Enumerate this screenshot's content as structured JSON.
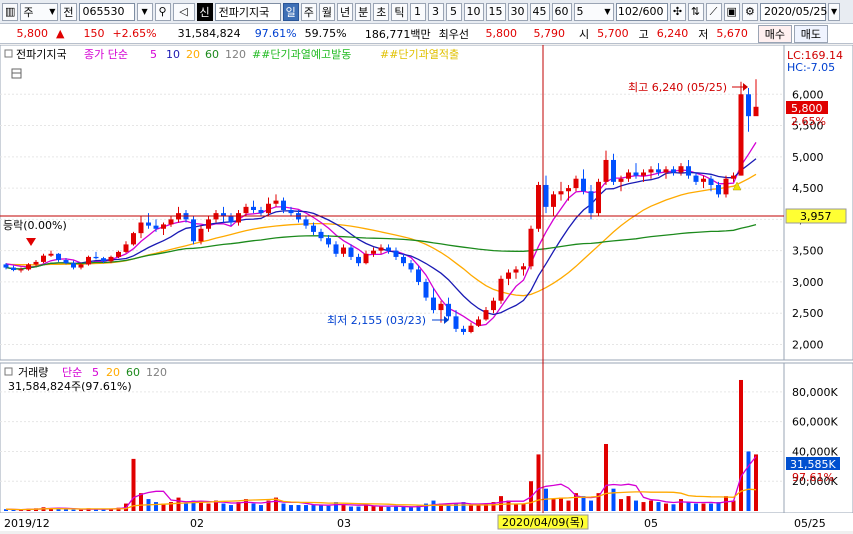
{
  "toolbar": {
    "market_label": "주",
    "type_label": "전",
    "stock_code": "065530",
    "stock_name": "전파기지국",
    "icon_si": "신",
    "period_tabs": [
      "일",
      "주",
      "월",
      "년",
      "분",
      "초",
      "틱"
    ],
    "period_numbers": [
      "1",
      "3",
      "5",
      "10",
      "15",
      "30",
      "45",
      "60"
    ],
    "count_value": "5",
    "page_count": "102/600",
    "date": "2020/05/25"
  },
  "quote": {
    "price": "5,800",
    "arrow": "▲",
    "change": "150",
    "change_pct": "+2.65%",
    "volume": "31,584,824",
    "vol_ratio": "97.61%",
    "turnover": "59.75%",
    "amount": "186,771백만",
    "best_label": "최우선",
    "ask": "5,800",
    "bid": "5,790",
    "open_label": "시",
    "open": "5,700",
    "high_label": "고",
    "high": "6,240",
    "low_label": "저",
    "low": "5,670",
    "buy_label": "매수",
    "sell_label": "매도"
  },
  "price_panel": {
    "legend_name": "전파기지국",
    "legend_ma": "종가 단순",
    "ma_periods": [
      "5",
      "10",
      "20",
      "60",
      "120"
    ],
    "legend_signal1": "##단기과열예고발동",
    "legend_signal2": "##단기과열적출",
    "lc_label": "LC:169.14",
    "hc_label": "HC:-7.05",
    "crosshair_text": "등락(0.00%)",
    "high_annot": "최고 6,240 (05/25)",
    "low_annot": "최저 2,155 (03/23)",
    "y_ticks": [
      "6,000",
      "5,500",
      "5,000",
      "4,500",
      "4,000",
      "3,500",
      "3,000",
      "2,500",
      "2,000"
    ],
    "last_price_tag": "5,800",
    "last_pct_tag": "2.65%",
    "crosshair_price_tag": "3,957"
  },
  "volume_panel": {
    "legend_name": "거래량",
    "legend_ma": "단순",
    "ma_periods": [
      "5",
      "20",
      "60",
      "120"
    ],
    "vol_info": "31,584,824주(97.61%)",
    "y_ticks": [
      "80,000K",
      "60,000K",
      "40,000K",
      "20,000K"
    ],
    "vol_tag": "31,585K",
    "pct_tag": "97.61%"
  },
  "x_axis": {
    "labels": [
      "2019/12",
      "02",
      "03",
      "05",
      "05/25"
    ],
    "crosshair_date": "2020/04/09(목)"
  },
  "colors": {
    "up": "#e00000",
    "down": "#0050ff",
    "ma5": "#d400d4",
    "ma10": "#1a1ab4",
    "ma20": "#ffaa00",
    "ma60": "#1c8a1c",
    "ma120": "#808080"
  },
  "chart_data": {
    "type": "candlestick",
    "price_range": [
      1800,
      6500
    ],
    "volume_max": 90000,
    "candles": [
      [
        3280,
        3300,
        3200,
        3230
      ],
      [
        3230,
        3260,
        3170,
        3190
      ],
      [
        3190,
        3230,
        3150,
        3200
      ],
      [
        3200,
        3300,
        3180,
        3280
      ],
      [
        3280,
        3350,
        3250,
        3320
      ],
      [
        3320,
        3450,
        3300,
        3420
      ],
      [
        3420,
        3500,
        3400,
        3450
      ],
      [
        3450,
        3460,
        3320,
        3350
      ],
      [
        3350,
        3380,
        3280,
        3300
      ],
      [
        3300,
        3340,
        3200,
        3230
      ],
      [
        3230,
        3300,
        3200,
        3280
      ],
      [
        3280,
        3420,
        3260,
        3400
      ],
      [
        3400,
        3480,
        3360,
        3380
      ],
      [
        3380,
        3400,
        3300,
        3330
      ],
      [
        3330,
        3420,
        3300,
        3400
      ],
      [
        3400,
        3500,
        3380,
        3480
      ],
      [
        3480,
        3650,
        3460,
        3600
      ],
      [
        3600,
        3800,
        3580,
        3780
      ],
      [
        3780,
        4050,
        3700,
        3950
      ],
      [
        3950,
        4100,
        3850,
        3900
      ],
      [
        3900,
        4000,
        3800,
        3850
      ],
      [
        3850,
        3950,
        3750,
        3920
      ],
      [
        3920,
        4050,
        3880,
        4000
      ],
      [
        4000,
        4200,
        3950,
        4100
      ],
      [
        4100,
        4150,
        3950,
        4000
      ],
      [
        4000,
        4050,
        3600,
        3650
      ],
      [
        3650,
        3900,
        3600,
        3850
      ],
      [
        3850,
        4050,
        3800,
        4000
      ],
      [
        4000,
        4150,
        3950,
        4100
      ],
      [
        4100,
        4200,
        3950,
        4050
      ],
      [
        4050,
        4100,
        3900,
        3950
      ],
      [
        3950,
        4150,
        3900,
        4100
      ],
      [
        4100,
        4250,
        4050,
        4200
      ],
      [
        4200,
        4300,
        4100,
        4150
      ],
      [
        4150,
        4200,
        4050,
        4100
      ],
      [
        4100,
        4350,
        4050,
        4250
      ],
      [
        4250,
        4400,
        4200,
        4300
      ],
      [
        4300,
        4350,
        4100,
        4150
      ],
      [
        4150,
        4200,
        4050,
        4100
      ],
      [
        4100,
        4150,
        3950,
        4000
      ],
      [
        4000,
        4050,
        3850,
        3900
      ],
      [
        3900,
        3950,
        3750,
        3800
      ],
      [
        3800,
        3850,
        3650,
        3700
      ],
      [
        3700,
        3750,
        3550,
        3600
      ],
      [
        3600,
        3650,
        3400,
        3450
      ],
      [
        3450,
        3600,
        3400,
        3550
      ],
      [
        3550,
        3600,
        3350,
        3400
      ],
      [
        3400,
        3450,
        3250,
        3300
      ],
      [
        3300,
        3500,
        3280,
        3450
      ],
      [
        3450,
        3550,
        3400,
        3500
      ],
      [
        3500,
        3600,
        3450,
        3550
      ],
      [
        3550,
        3600,
        3450,
        3500
      ],
      [
        3500,
        3550,
        3350,
        3400
      ],
      [
        3400,
        3450,
        3250,
        3300
      ],
      [
        3300,
        3350,
        3150,
        3200
      ],
      [
        3200,
        3250,
        2950,
        3000
      ],
      [
        3000,
        3050,
        2700,
        2750
      ],
      [
        2750,
        2900,
        2500,
        2550
      ],
      [
        2550,
        2700,
        2350,
        2650
      ],
      [
        2650,
        2750,
        2400,
        2450
      ],
      [
        2450,
        2550,
        2200,
        2250
      ],
      [
        2250,
        2300,
        2155,
        2200
      ],
      [
        2200,
        2350,
        2180,
        2300
      ],
      [
        2300,
        2450,
        2280,
        2400
      ],
      [
        2400,
        2600,
        2380,
        2550
      ],
      [
        2550,
        2750,
        2500,
        2700
      ],
      [
        2700,
        3100,
        2650,
        3050
      ],
      [
        3050,
        3200,
        2950,
        3150
      ],
      [
        3150,
        3250,
        3050,
        3200
      ],
      [
        3200,
        3300,
        3100,
        3250
      ],
      [
        3250,
        3900,
        3200,
        3850
      ],
      [
        3850,
        4600,
        3800,
        4550
      ],
      [
        4550,
        4700,
        4100,
        4200
      ],
      [
        4200,
        4450,
        4050,
        4400
      ],
      [
        4400,
        4600,
        4300,
        4450
      ],
      [
        4450,
        4550,
        4300,
        4500
      ],
      [
        4500,
        4700,
        4450,
        4650
      ],
      [
        4650,
        4800,
        4400,
        4450
      ],
      [
        4450,
        4550,
        4000,
        4100
      ],
      [
        4100,
        4650,
        4050,
        4600
      ],
      [
        4600,
        5100,
        4550,
        4950
      ],
      [
        4950,
        5050,
        4550,
        4600
      ],
      [
        4600,
        4700,
        4450,
        4650
      ],
      [
        4650,
        4800,
        4600,
        4750
      ],
      [
        4750,
        4900,
        4650,
        4700
      ],
      [
        4700,
        4800,
        4600,
        4750
      ],
      [
        4750,
        4850,
        4650,
        4800
      ],
      [
        4800,
        4900,
        4700,
        4750
      ],
      [
        4750,
        4850,
        4650,
        4800
      ],
      [
        4800,
        4850,
        4700,
        4750
      ],
      [
        4750,
        4900,
        4700,
        4850
      ],
      [
        4850,
        4950,
        4650,
        4700
      ],
      [
        4700,
        4750,
        4550,
        4600
      ],
      [
        4600,
        4700,
        4500,
        4650
      ],
      [
        4650,
        4700,
        4450,
        4550
      ],
      [
        4550,
        4600,
        4350,
        4400
      ],
      [
        4400,
        4700,
        4350,
        4650
      ],
      [
        4650,
        4750,
        4600,
        4700
      ],
      [
        4700,
        6200,
        4700,
        6000
      ],
      [
        6000,
        6100,
        5400,
        5650
      ],
      [
        5650,
        6240,
        5670,
        5800
      ]
    ],
    "volumes": [
      1200,
      900,
      800,
      1500,
      1800,
      2500,
      2000,
      1500,
      1100,
      900,
      900,
      1800,
      1400,
      1100,
      1300,
      2200,
      5000,
      35000,
      12000,
      8000,
      6000,
      5000,
      6000,
      9000,
      5000,
      7000,
      6000,
      5000,
      7000,
      5000,
      4000,
      6000,
      8000,
      5000,
      4000,
      7000,
      9000,
      5000,
      4000,
      4000,
      4000,
      4000,
      4000,
      3500,
      6000,
      4000,
      3000,
      3000,
      4000,
      3500,
      3000,
      2800,
      3000,
      2800,
      2600,
      3500,
      5000,
      7000,
      5000,
      4000,
      5000,
      6000,
      4000,
      4500,
      5000,
      6000,
      10000,
      7000,
      5000,
      5000,
      20000,
      38000,
      15000,
      8000,
      9000,
      7000,
      12000,
      10000,
      7000,
      12000,
      45000,
      15000,
      8000,
      10000,
      7000,
      6000,
      7000,
      6000,
      5000,
      4500,
      8000,
      6000,
      5000,
      5000,
      5000,
      6000,
      10000,
      7000,
      88000,
      40000,
      38000
    ],
    "ma5_series": [
      3290,
      3270,
      3250,
      3240,
      3244,
      3290,
      3340,
      3364,
      3368,
      3350,
      3302,
      3288,
      3324,
      3324,
      3358,
      3398,
      3448,
      3532,
      3648,
      3742,
      3840,
      3880,
      3924,
      3954,
      3974,
      3934,
      3924,
      3900,
      3930,
      3930,
      3890,
      3998,
      4080,
      4090,
      4102,
      4160,
      4200,
      4200,
      4180,
      4160,
      4100,
      4030,
      3950,
      3860,
      3750,
      3660,
      3590,
      3520,
      3430,
      3440,
      3440,
      3490,
      3490,
      3450,
      3390,
      3260,
      3110,
      2900,
      2720,
      2580,
      2520,
      2450,
      2370,
      2300,
      2320,
      2430,
      2600,
      2770,
      2930,
      3030,
      3300,
      3570,
      3800,
      4000,
      4170,
      4340,
      4440,
      4450,
      4420,
      4450,
      4600,
      4660,
      4660,
      4680,
      4700,
      4690,
      4710,
      4740,
      4760,
      4770,
      4790,
      4780,
      4740,
      4700,
      4640,
      4570,
      4570,
      4580,
      4860,
      5040,
      5230
    ],
    "ma20_series": [
      3280,
      3278,
      3276,
      3274,
      3272,
      3275,
      3280,
      3282,
      3284,
      3285,
      3284,
      3288,
      3295,
      3300,
      3308,
      3320,
      3340,
      3368,
      3400,
      3432,
      3460,
      3490,
      3520,
      3550,
      3580,
      3610,
      3640,
      3665,
      3700,
      3728,
      3758,
      3790,
      3820,
      3845,
      3865,
      3880,
      3895,
      3905,
      3915,
      3922,
      3928,
      3932,
      3932,
      3928,
      3920,
      3908,
      3892,
      3872,
      3850,
      3825,
      3800,
      3775,
      3748,
      3720,
      3690,
      3650,
      3600,
      3540,
      3470,
      3390,
      3300,
      3210,
      3110,
      3020,
      2940,
      2880,
      2840,
      2810,
      2790,
      2780,
      2800,
      2850,
      2910,
      2980,
      3060,
      3150,
      3250,
      3360,
      3470,
      3580,
      3690,
      3800,
      3900,
      3990,
      4070,
      4150,
      4210,
      4260,
      4310,
      4350,
      4390,
      4420,
      4440,
      4460,
      4480,
      4490,
      4510,
      4530,
      4590,
      4650,
      4720
    ]
  }
}
